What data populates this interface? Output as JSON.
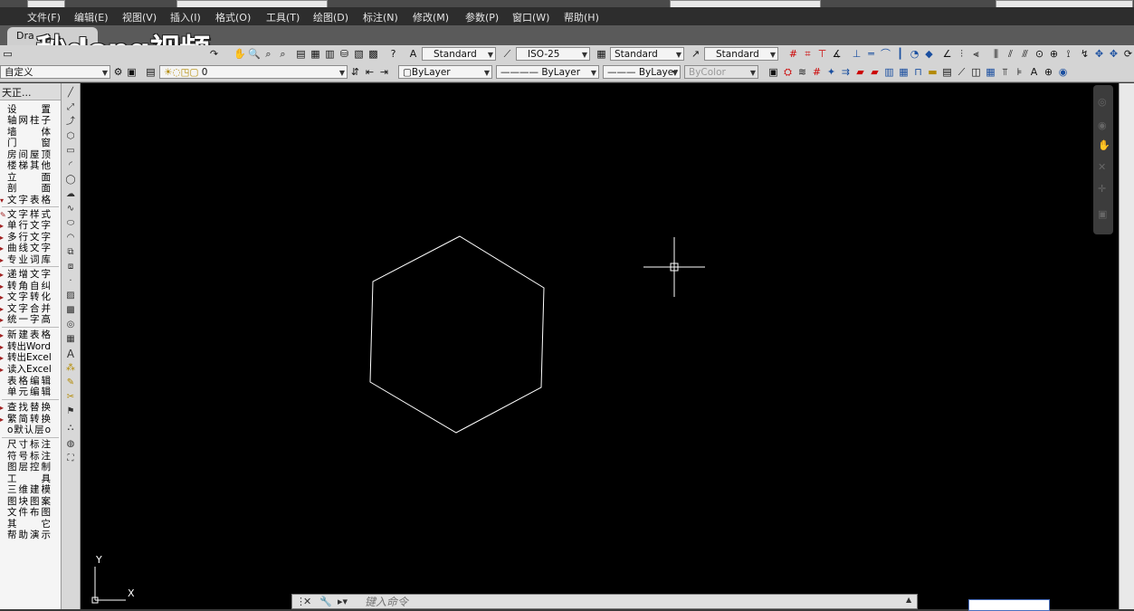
{
  "menu": {
    "items": [
      "文件(F)",
      "编辑(E)",
      "视图(V)",
      "插入(I)",
      "格式(O)",
      "工具(T)",
      "绘图(D)",
      "标注(N)",
      "修改(M)",
      "参数(P)",
      "窗口(W)",
      "帮助(H)"
    ]
  },
  "tab": {
    "label": "Dra"
  },
  "watermark": {
    "text": "秒dong视频"
  },
  "toolbar1": {
    "text_style": "Standard",
    "dim_style": "ISO-25",
    "table_style": "Standard",
    "multileader_style": "Standard"
  },
  "toolbar2": {
    "workspace": "自定义",
    "layer": "0",
    "color": "ByLayer",
    "linetype": "———— ByLayer",
    "lineweight": "——— ByLayer",
    "plotstyle": "ByColor"
  },
  "panel": {
    "title": "天正...",
    "groups": [
      [
        "设　置",
        "轴网柱子",
        "墙　体",
        "门　窗",
        "房间屋顶",
        "楼梯其他",
        "立　面",
        "剖　面",
        "文字表格"
      ],
      [
        "文字样式",
        "单行文字",
        "多行文字",
        "曲线文字",
        "专业词库"
      ],
      [
        "递增文字",
        "转角自纠",
        "文字转化",
        "文字合并",
        "统一字高"
      ],
      [
        "新建表格",
        "转出Word",
        "转出Excel",
        "读入Excel",
        "表格编辑",
        "单元编辑"
      ],
      [
        "查找替换",
        "繁简转换",
        "o默认层o"
      ],
      [
        "尺寸标注",
        "符号标注",
        "图层控制",
        "工　具",
        "三维建模",
        "图块图案",
        "文件布图",
        "其　它",
        "帮助演示"
      ]
    ]
  },
  "ucs": {
    "x_label": "X",
    "y_label": "Y"
  },
  "command": {
    "placeholder": "键入命令"
  },
  "colors": {
    "canvas": "#000000",
    "geometry": "#ffffff",
    "menubar": "#2d2d2d"
  }
}
